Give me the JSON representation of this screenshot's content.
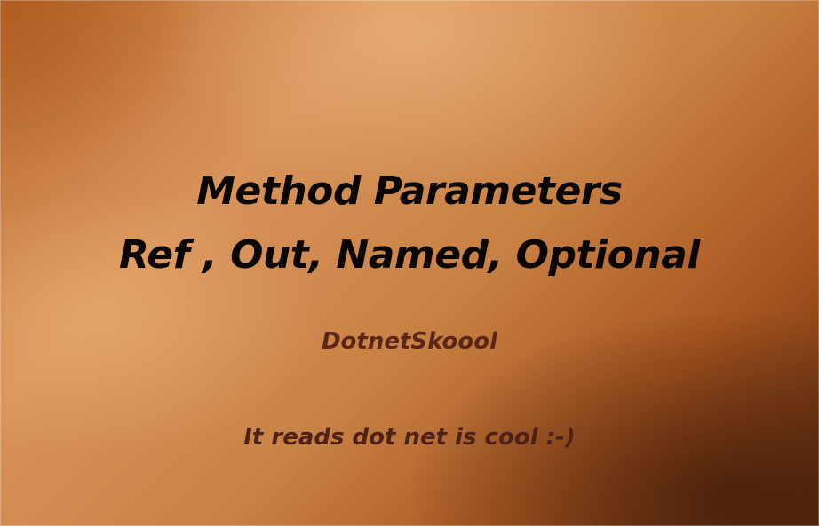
{
  "slide": {
    "title_line1": "Method Parameters",
    "title_line2": "Ref , Out, Named, Optional",
    "brand": "DotnetSkoool",
    "tagline": "It reads dot net is cool :-)"
  },
  "colors": {
    "title_text": "#0a0603",
    "brand_text": "#5a2618",
    "tagline_text": "#4e2218",
    "background_light": "#d8935a",
    "background_dark": "#5e2c10"
  }
}
